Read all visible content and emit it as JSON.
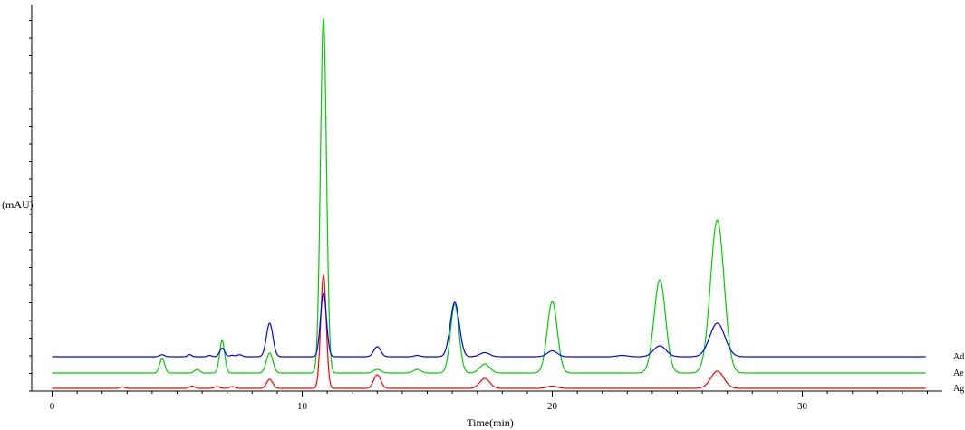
{
  "chart_data": {
    "type": "line",
    "title": "",
    "xlabel": "Time(min)",
    "ylabel": "(mAU)",
    "xlim": [
      -0.8,
      35
    ],
    "x_ticks": [
      0,
      10,
      20,
      30
    ],
    "grid": false,
    "legend": "right-edge labels",
    "series": [
      {
        "name": "Ad",
        "color": "#0000ff",
        "baseline": 37,
        "peaks": [
          [
            4.4,
            2.2,
            0.1
          ],
          [
            5.5,
            2.4,
            0.08
          ],
          [
            6.3,
            1.5,
            0.08
          ],
          [
            6.8,
            9.5,
            0.1
          ],
          [
            7.2,
            1.6,
            0.1
          ],
          [
            7.5,
            2.2,
            0.1
          ],
          [
            8.7,
            37,
            0.13
          ],
          [
            10.85,
            70,
            0.12
          ],
          [
            13.0,
            11,
            0.14
          ],
          [
            14.6,
            1.5,
            0.12
          ],
          [
            16.1,
            60,
            0.18
          ],
          [
            17.3,
            4.5,
            0.2
          ],
          [
            20.0,
            6.5,
            0.2
          ],
          [
            22.8,
            1.5,
            0.2
          ],
          [
            24.3,
            12,
            0.25
          ],
          [
            26.6,
            37,
            0.3
          ]
        ]
      },
      {
        "name": "Ae",
        "color": "#00cc00",
        "baseline": 19,
        "peaks": [
          [
            4.4,
            16,
            0.1
          ],
          [
            5.8,
            4,
            0.1
          ],
          [
            6.8,
            36,
            0.1
          ],
          [
            8.7,
            22,
            0.13
          ],
          [
            10.85,
            392,
            0.12
          ],
          [
            13.0,
            4,
            0.15
          ],
          [
            14.6,
            4,
            0.15
          ],
          [
            16.1,
            76,
            0.17
          ],
          [
            17.3,
            10,
            0.2
          ],
          [
            20.0,
            79,
            0.2
          ],
          [
            24.3,
            103,
            0.23
          ],
          [
            26.6,
            169,
            0.27
          ]
        ]
      },
      {
        "name": "Ag",
        "color": "#ff0000",
        "baseline": 2,
        "peaks": [
          [
            2.8,
            1.5,
            0.1
          ],
          [
            5.6,
            2.5,
            0.1
          ],
          [
            6.6,
            2,
            0.1
          ],
          [
            7.2,
            2,
            0.1
          ],
          [
            8.7,
            10,
            0.12
          ],
          [
            10.85,
            125,
            0.11
          ],
          [
            13.0,
            15,
            0.14
          ],
          [
            17.3,
            11,
            0.2
          ],
          [
            20.0,
            2.5,
            0.2
          ],
          [
            26.6,
            19,
            0.26
          ]
        ]
      }
    ]
  }
}
